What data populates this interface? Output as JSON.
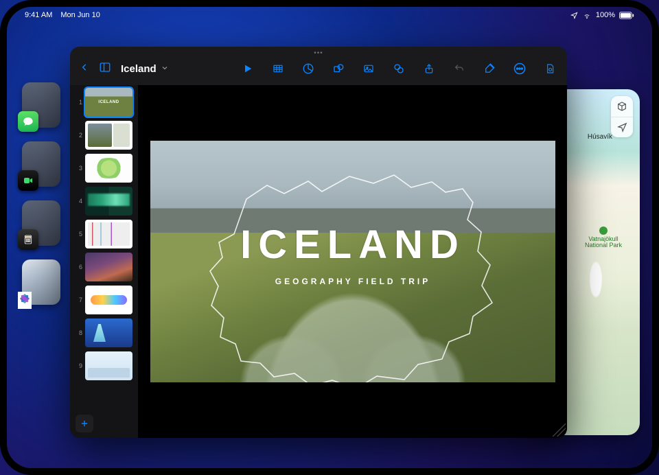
{
  "statusbar": {
    "time": "9:41 AM",
    "date": "Mon Jun 10",
    "battery_pct": "100%"
  },
  "keynote": {
    "doc_title": "Iceland",
    "toolbar_icons": [
      "play-icon",
      "table-icon",
      "chart-icon",
      "shapes-icon",
      "image-icon",
      "effects-icon",
      "share-icon",
      "undo-icon",
      "paint-icon",
      "more-icon",
      "document-icon"
    ],
    "slides": [
      {
        "num": "1",
        "label": "ICELAND"
      },
      {
        "num": "2",
        "label": ""
      },
      {
        "num": "3",
        "label": ""
      },
      {
        "num": "4",
        "label": ""
      },
      {
        "num": "5",
        "label": ""
      },
      {
        "num": "6",
        "label": ""
      },
      {
        "num": "7",
        "label": ""
      },
      {
        "num": "8",
        "label": ""
      },
      {
        "num": "9",
        "label": ""
      }
    ],
    "main_slide": {
      "title": "ICELAND",
      "subtitle": "GEOGRAPHY FIELD TRIP"
    }
  },
  "maps": {
    "city": "Húsavík",
    "park": "Vatnajökull National Park"
  },
  "colors": {
    "accent": "#0a84ff"
  }
}
